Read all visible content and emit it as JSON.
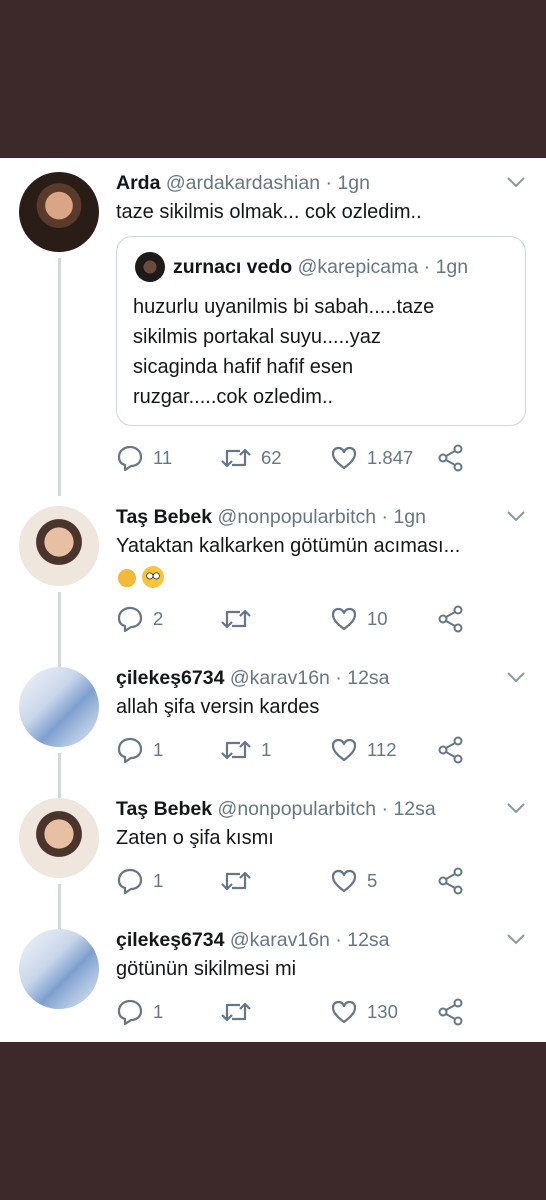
{
  "colors": {
    "frame_bg": "#3d2929",
    "panel_bg": "#ffffff",
    "text": "#14171a",
    "muted": "#657786",
    "line": "#cfd9de"
  },
  "tweets": [
    {
      "name": "Arda",
      "handle": "@ardakardashian",
      "time": "1gn",
      "text": "taze sikilmis olmak... cok ozledim..",
      "avatar": "avatar-face",
      "quote": {
        "name": "zurnacı vedo",
        "handle": "@karepicama",
        "time": "1gn",
        "text": "huzurlu uyanilmis bi sabah.....taze\nsikilmis portakal suyu.....yaz\nsicaginda hafif hafif esen\nruzgar.....cok ozledim.."
      },
      "replies": "11",
      "retweets": "62",
      "likes": "1.847"
    },
    {
      "name": "Taş Bebek",
      "handle": "@nonpopularbitch",
      "time": "1gn",
      "text": "Yataktan kalkarken götümün acıması...",
      "emojis": [
        "folded-hands-icon",
        "flushed-face-icon"
      ],
      "replies": "2",
      "retweets": "",
      "likes": "10"
    },
    {
      "name": "çilekeş6734",
      "handle": "@karav16n",
      "time": "12sa",
      "text": "allah şifa versin kardes",
      "replies": "1",
      "retweets": "1",
      "likes": "112"
    },
    {
      "name": "Taş Bebek",
      "handle": "@nonpopularbitch",
      "time": "12sa",
      "text": "Zaten o şifa kısmı",
      "replies": "1",
      "retweets": "",
      "likes": "5"
    },
    {
      "name": "çilekeş6734",
      "handle": "@karav16n",
      "time": "12sa",
      "text": "götünün sikilmesi mi",
      "replies": "1",
      "retweets": "",
      "likes": "130"
    }
  ],
  "separator": "·"
}
